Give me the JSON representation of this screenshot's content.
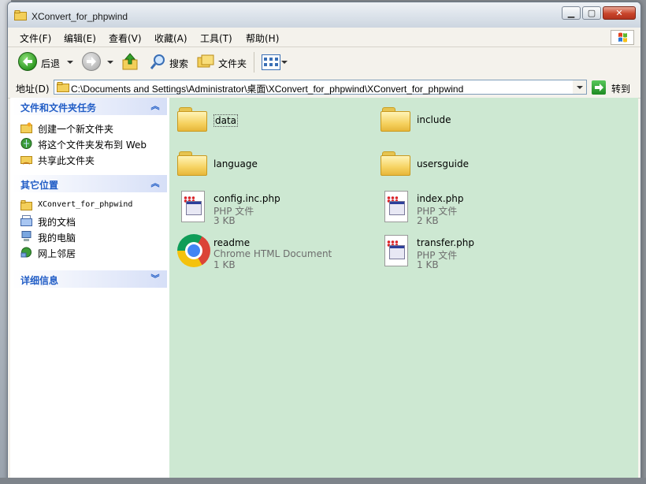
{
  "window": {
    "title": "XConvert_for_phpwind"
  },
  "menu": [
    "文件(F)",
    "编辑(E)",
    "查看(V)",
    "收藏(A)",
    "工具(T)",
    "帮助(H)"
  ],
  "toolbar": {
    "back": "后退",
    "search": "搜索",
    "folders": "文件夹"
  },
  "address": {
    "label": "地址(D)",
    "path": "C:\\Documents and Settings\\Administrator\\桌面\\XConvert_for_phpwind\\XConvert_for_phpwind",
    "go": "转到"
  },
  "left_pane": {
    "tasks": {
      "title": "文件和文件夹任务",
      "items": [
        "创建一个新文件夹",
        "将这个文件夹发布到 Web",
        "共享此文件夹"
      ]
    },
    "places": {
      "title": "其它位置",
      "items": [
        "XConvert_for_phpwind",
        "我的文档",
        "我的电脑",
        "网上邻居"
      ]
    },
    "details": {
      "title": "详细信息"
    }
  },
  "files": [
    {
      "name": "data",
      "kind": "folder"
    },
    {
      "name": "include",
      "kind": "folder"
    },
    {
      "name": "language",
      "kind": "folder"
    },
    {
      "name": "usersguide",
      "kind": "folder"
    },
    {
      "name": "config.inc.php",
      "type": "PHP 文件",
      "size": "3 KB",
      "kind": "php"
    },
    {
      "name": "index.php",
      "type": "PHP 文件",
      "size": "2 KB",
      "kind": "php"
    },
    {
      "name": "readme",
      "type": "Chrome HTML Document",
      "size": "1 KB",
      "kind": "chrome"
    },
    {
      "name": "transfer.php",
      "type": "PHP 文件",
      "size": "1 KB",
      "kind": "php"
    }
  ],
  "colors": {
    "content_bg": "#cde8d2",
    "task_header": "#215dc6"
  }
}
